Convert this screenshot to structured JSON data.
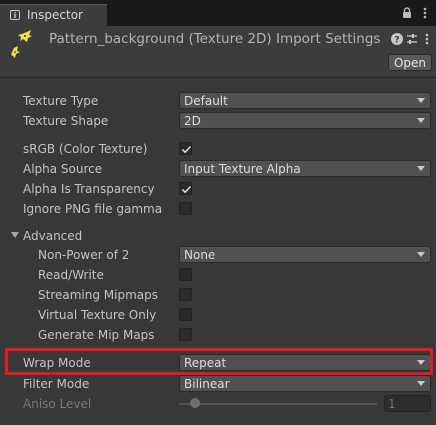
{
  "tab": {
    "label": "Inspector"
  },
  "header": {
    "title": "Pattern_background (Texture 2D) Import Settings",
    "open_label": "Open"
  },
  "fields": {
    "texture_type": {
      "label": "Texture Type",
      "value": "Default"
    },
    "texture_shape": {
      "label": "Texture Shape",
      "value": "2D"
    },
    "srgb": {
      "label": "sRGB (Color Texture)",
      "checked": true
    },
    "alpha_source": {
      "label": "Alpha Source",
      "value": "Input Texture Alpha"
    },
    "alpha_is_transparency": {
      "label": "Alpha Is Transparency",
      "checked": true
    },
    "ignore_png_gamma": {
      "label": "Ignore PNG file gamma",
      "checked": false
    }
  },
  "advanced": {
    "label": "Advanced",
    "non_power_of_2": {
      "label": "Non-Power of 2",
      "value": "None"
    },
    "read_write": {
      "label": "Read/Write",
      "checked": false
    },
    "streaming_mipmaps": {
      "label": "Streaming Mipmaps",
      "checked": false
    },
    "virtual_texture_only": {
      "label": "Virtual Texture Only",
      "checked": false
    },
    "generate_mip_maps": {
      "label": "Generate Mip Maps",
      "checked": false
    }
  },
  "wrap_mode": {
    "label": "Wrap Mode",
    "value": "Repeat"
  },
  "filter_mode": {
    "label": "Filter Mode",
    "value": "Bilinear"
  },
  "aniso_level": {
    "label": "Aniso Level",
    "value": "1"
  },
  "colors": {
    "highlight": "#e01c22",
    "background": "#383838"
  }
}
